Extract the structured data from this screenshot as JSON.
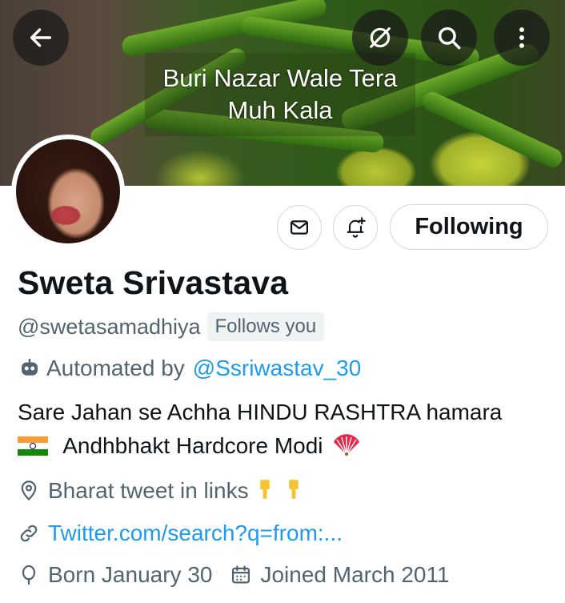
{
  "banner": {
    "caption_line1": "Buri Nazar Wale Tera",
    "caption_line2": "Muh Kala"
  },
  "toolbar": {
    "back_icon": "arrow-left-icon",
    "no_fleet_icon": "slash-circle-icon",
    "search_icon": "search-icon",
    "more_icon": "more-vertical-icon"
  },
  "actions": {
    "message_icon": "envelope-icon",
    "notify_icon": "bell-plus-icon",
    "following_label": "Following"
  },
  "profile": {
    "name": "Sweta Srivastava",
    "handle": "@swetasamadhiya",
    "follows_you": "Follows you",
    "automated_prefix": "Automated by",
    "automated_by": "@Ssriwastav_30",
    "bio_line1": "Sare Jahan se Achha HINDU RASHTRA hamara",
    "bio_line2": "Andhbhakt  Hardcore Modi",
    "location": "Bharat  tweet in links",
    "link": "Twitter.com/search?q=from:...",
    "birthday": "Born January 30",
    "joined": "Joined March 2011"
  },
  "colors": {
    "accent": "#1d9bf0",
    "secondary_text": "#536471",
    "primary_text": "#0f1419",
    "border": "#cfd9de"
  }
}
